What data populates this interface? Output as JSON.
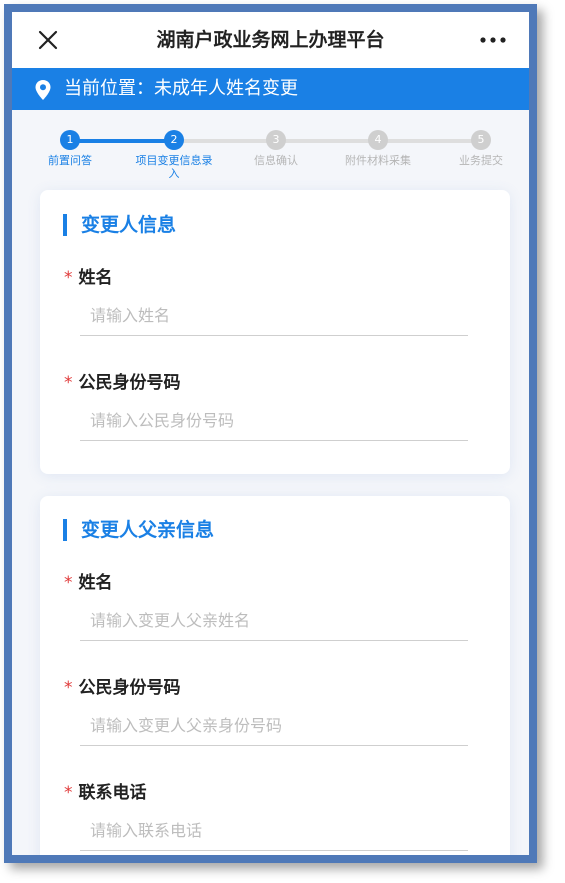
{
  "header": {
    "title": "湖南户政业务网上办理平台"
  },
  "location": {
    "prefix": "当前位置：",
    "value": "未成年人姓名变更"
  },
  "steps": [
    {
      "num": "1",
      "label": "前置问答",
      "active": true
    },
    {
      "num": "2",
      "label": "项目变更信息录入",
      "active": true
    },
    {
      "num": "3",
      "label": "信息确认",
      "active": false
    },
    {
      "num": "4",
      "label": "附件材料采集",
      "active": false
    },
    {
      "num": "5",
      "label": "业务提交",
      "active": false
    }
  ],
  "sections": [
    {
      "title": "变更人信息",
      "fields": [
        {
          "label": "姓名",
          "required_mark": "*",
          "value": "",
          "placeholder": "请输入姓名"
        },
        {
          "label": "公民身份号码",
          "required_mark": "*",
          "value": "",
          "placeholder": "请输入公民身份号码"
        }
      ]
    },
    {
      "title": "变更人父亲信息",
      "fields": [
        {
          "label": "姓名",
          "required_mark": "*",
          "value": "",
          "placeholder": "请输入变更人父亲姓名"
        },
        {
          "label": "公民身份号码",
          "required_mark": "*",
          "value": "",
          "placeholder": "请输入变更人父亲身份号码"
        },
        {
          "label": "联系电话",
          "required_mark": "*",
          "value": "",
          "placeholder": "请输入联系电话"
        }
      ]
    }
  ],
  "colors": {
    "accent": "#1a80e5",
    "required": "#e03a3a",
    "frame": "#4f79b8"
  },
  "icons": {
    "close": "close-icon",
    "more": "more-icon",
    "location": "location-pin-icon"
  }
}
